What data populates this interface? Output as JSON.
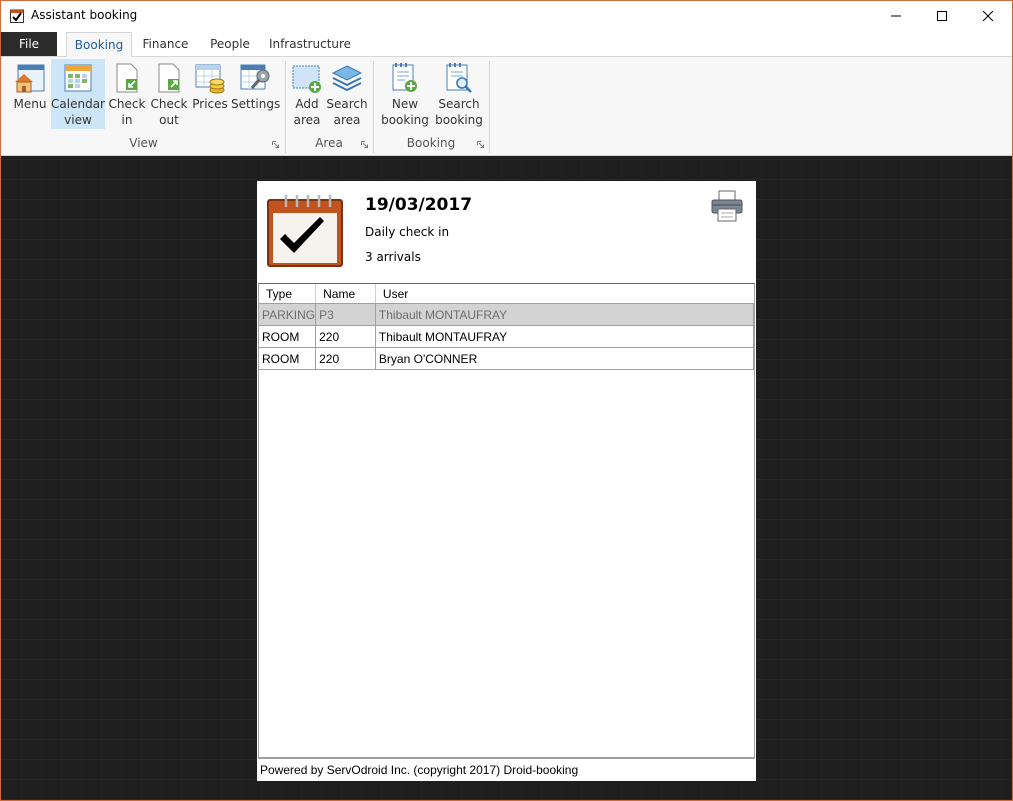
{
  "window": {
    "title": "Assistant booking"
  },
  "tabs": [
    {
      "label": "File"
    },
    {
      "label": "Booking"
    },
    {
      "label": "Finance"
    },
    {
      "label": "People"
    },
    {
      "label": "Infrastructure"
    }
  ],
  "ribbon": {
    "view": {
      "label": "View",
      "buttons": [
        {
          "line1": "Menu",
          "line2": ""
        },
        {
          "line1": "Calendar",
          "line2": "view"
        },
        {
          "line1": "Check",
          "line2": "in"
        },
        {
          "line1": "Check",
          "line2": "out"
        },
        {
          "line1": "Prices",
          "line2": ""
        },
        {
          "line1": "Settings",
          "line2": ""
        }
      ]
    },
    "area": {
      "label": "Area",
      "buttons": [
        {
          "line1": "Add",
          "line2": "area"
        },
        {
          "line1": "Search",
          "line2": "area"
        }
      ]
    },
    "booking": {
      "label": "Booking",
      "buttons": [
        {
          "line1": "New",
          "line2": "booking"
        },
        {
          "line1": "Search",
          "line2": "booking"
        }
      ]
    }
  },
  "report": {
    "date": "19/03/2017",
    "subtitle": "Daily check in",
    "count": "3 arrivals",
    "columns": [
      "Type",
      "Name",
      "User"
    ],
    "rows": [
      {
        "type": "PARKING",
        "name": "P3",
        "user": "Thibault MONTAUFRAY"
      },
      {
        "type": "ROOM",
        "name": "220",
        "user": "Thibault MONTAUFRAY"
      },
      {
        "type": "ROOM",
        "name": "220",
        "user": "Bryan O'CONNER"
      }
    ],
    "footer": "Powered by ServOdroid  Inc. (copyright 2017) Droid-booking"
  },
  "colors": {
    "accent": "#1e5d9a",
    "window_border": "#d06a3a",
    "selected_row": "#d3d3d3",
    "content_bg": "#1f1f1f"
  }
}
